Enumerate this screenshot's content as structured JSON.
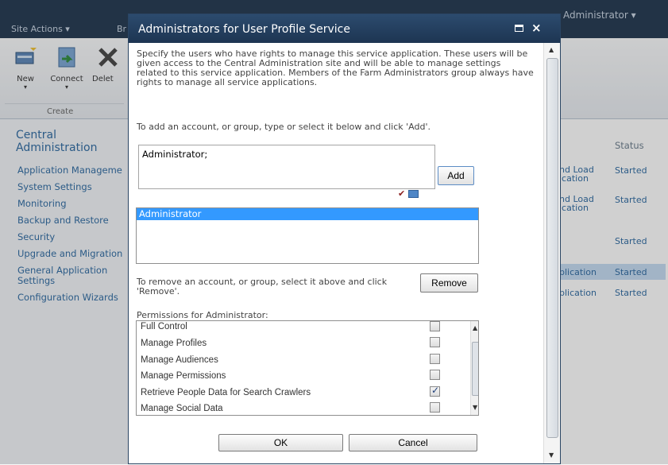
{
  "topbar": {
    "site_actions": "Site Actions ▾",
    "browse": "Br",
    "user": "Administrator ▾"
  },
  "ribbon": {
    "new_label": "New",
    "connect_label": "Connect",
    "delete_label": "Delet",
    "group_label": "Create"
  },
  "leftnav": {
    "heading": "Central Administration",
    "items": [
      "Application Manageme",
      "System Settings",
      "Monitoring",
      "Backup and Restore",
      "Security",
      "Upgrade and Migration",
      "General Application Settings",
      "Configuration Wizards"
    ]
  },
  "right": {
    "status_header": "Status",
    "rows": [
      {
        "name": "nd Load ication",
        "status": "Started"
      },
      {
        "name": "nd Load ication",
        "status": "Started"
      },
      {
        "name": "",
        "status": "Started"
      },
      {
        "name": "plication",
        "status": "Started"
      },
      {
        "name": "plication",
        "status": "Started"
      }
    ]
  },
  "dialog": {
    "title": "Administrators for User Profile Service",
    "intro": "Specify the users who have rights to manage this service application. These users will be given access to the Central Administration site and will be able to manage settings related to this service application. Members of the Farm Administrators group always have rights to manage all service applications.",
    "add_instruction": "To add an account, or group, type or select it below and click 'Add'.",
    "people_value": "Administrator;",
    "add_button": "Add",
    "list_items": [
      "Administrator"
    ],
    "remove_instruction": "To remove an account, or group, select it above and click 'Remove'.",
    "remove_button": "Remove",
    "permissions_label": "Permissions for Administrator:",
    "permissions": [
      {
        "label": "Full Control",
        "checked": false
      },
      {
        "label": "Manage Profiles",
        "checked": false
      },
      {
        "label": "Manage Audiences",
        "checked": false
      },
      {
        "label": "Manage Permissions",
        "checked": false
      },
      {
        "label": "Retrieve People Data for Search Crawlers",
        "checked": true
      },
      {
        "label": "Manage Social Data",
        "checked": false
      }
    ],
    "ok_button": "OK",
    "cancel_button": "Cancel"
  }
}
